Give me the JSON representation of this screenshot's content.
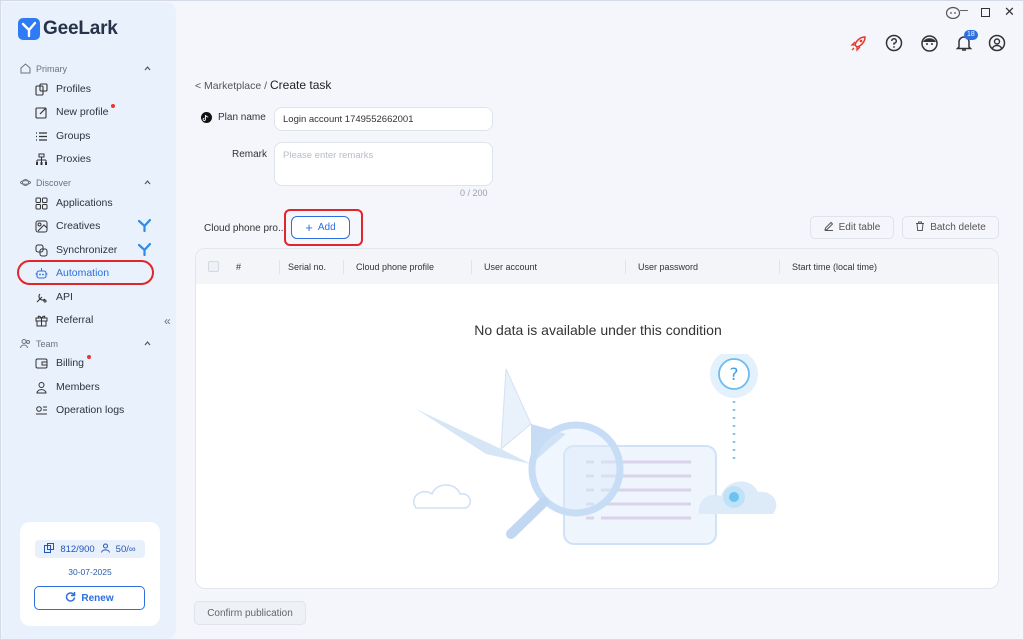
{
  "app": {
    "name": "GeeLark"
  },
  "sidebar": {
    "sections": {
      "primary": "Primary",
      "discover": "Discover",
      "team": "Team"
    },
    "items": {
      "profiles": "Profiles",
      "new_profile": "New profile",
      "groups": "Groups",
      "proxies": "Proxies",
      "applications": "Applications",
      "creatives": "Creatives",
      "synchronizer": "Synchronizer",
      "automation": "Automation",
      "api": "API",
      "referral": "Referral",
      "billing": "Billing",
      "members": "Members",
      "operation_logs": "Operation logs"
    },
    "selected": "Automation",
    "account": {
      "profiles_count": "812/900",
      "members_count": "50/∞",
      "expiry": "30-07-2025",
      "renew_label": "Renew"
    }
  },
  "topbar": {
    "notification_count": "18"
  },
  "breadcrumb": {
    "parent": "< Marketplace",
    "separator": "/",
    "current": "Create task"
  },
  "form": {
    "plan_name_label": "Plan name",
    "plan_name_value": "Login account 1749552662001",
    "remark_label": "Remark",
    "remark_placeholder": "Please enter remarks",
    "remark_counter": "0 / 200",
    "cloud_phone_label": "Cloud phone pro...",
    "add_label": "Add"
  },
  "toolbar": {
    "edit_table": "Edit table",
    "batch_delete": "Batch delete"
  },
  "table": {
    "columns": [
      "#",
      "Serial no.",
      "Cloud phone profile",
      "User account",
      "User password",
      "Start time (local time)"
    ],
    "rows": [],
    "empty_text": "No data is available under this condition"
  },
  "footer": {
    "confirm_label": "Confirm publication"
  },
  "colors": {
    "accent": "#2d6fe0",
    "highlight_ring": "#e0262a",
    "sidebar_bg": "#e8f1fc",
    "rocket": "#e8372c"
  }
}
